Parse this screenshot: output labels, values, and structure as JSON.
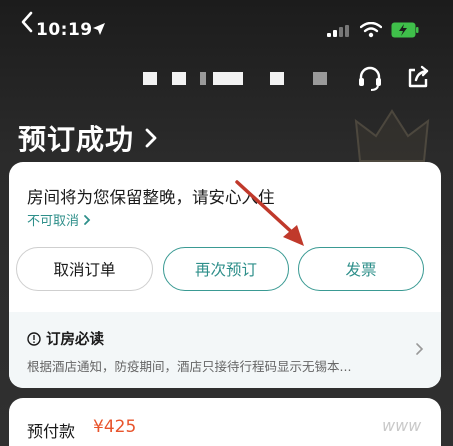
{
  "status_bar": {
    "time": "10:19"
  },
  "header": {
    "title": "预订成功"
  },
  "card": {
    "room_message": "房间将为您保留整晚，请安心入住",
    "cancel_policy": "不可取消",
    "buttons": {
      "cancel": "取消订单",
      "rebook": "再次预订",
      "invoice": "发票"
    },
    "notice": {
      "title": "订房必读",
      "text": "根据酒店通知，防疫期间，酒店只接待行程码显示无锡本..."
    }
  },
  "prepay": {
    "label": "预付款",
    "amount": "¥425"
  },
  "watermark": "www",
  "colors": {
    "accent": "#2e8f8a",
    "price": "#e8542c",
    "annotation": "#c0392b"
  }
}
